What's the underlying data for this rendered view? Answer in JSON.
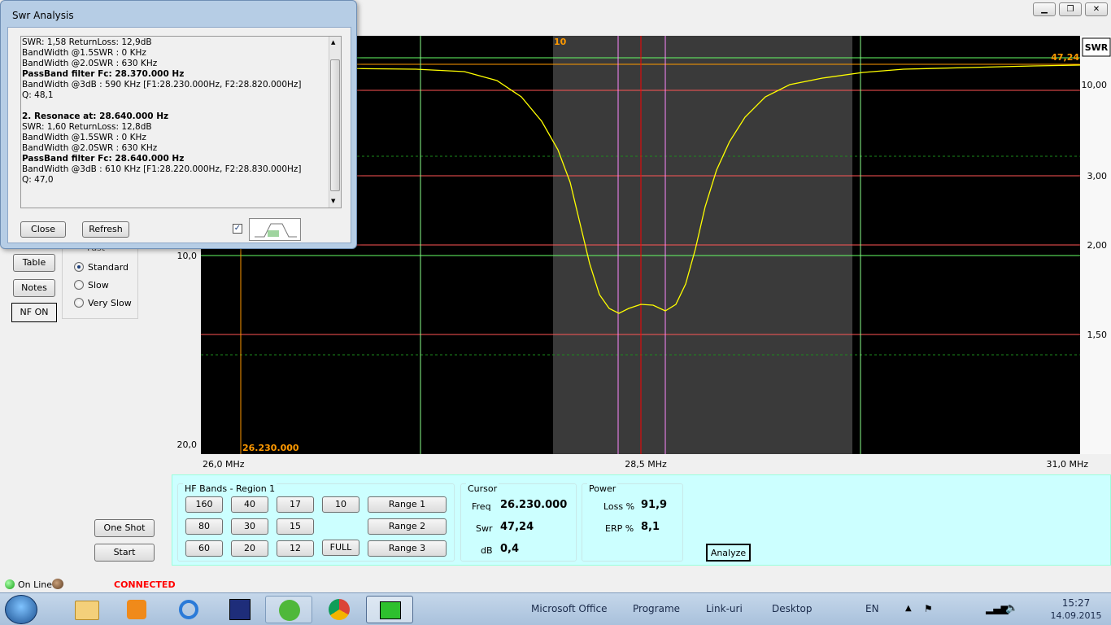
{
  "dialog": {
    "title": "Swr Analysis",
    "lines": [
      {
        "text": "SWR: 1,58 ReturnLoss: 12,9dB",
        "bold": false
      },
      {
        "text": "BandWidth @1.5SWR : 0 KHz",
        "bold": false
      },
      {
        "text": "BandWidth @2.0SWR : 630 KHz",
        "bold": false
      },
      {
        "text": "PassBand filter Fc: 28.370.000 Hz",
        "bold": true
      },
      {
        "text": "BandWidth @3dB : 590 KHz [F1:28.230.000Hz, F2:28.820.000Hz]",
        "bold": false
      },
      {
        "text": "Q: 48,1",
        "bold": false
      },
      {
        "text": "",
        "bold": false
      },
      {
        "text": "2. Resonace at: 28.640.000 Hz",
        "bold": true
      },
      {
        "text": "SWR: 1,60 ReturnLoss: 12,8dB",
        "bold": false
      },
      {
        "text": "BandWidth @1.5SWR : 0 KHz",
        "bold": false
      },
      {
        "text": "BandWidth @2.0SWR : 630 KHz",
        "bold": false
      },
      {
        "text": "PassBand filter Fc: 28.640.000 Hz",
        "bold": true
      },
      {
        "text": "BandWidth @3dB : 610 KHz [F1:28.220.000Hz, F2:28.830.000Hz]",
        "bold": false
      },
      {
        "text": "Q: 47,0",
        "bold": false
      }
    ],
    "close_label": "Close",
    "refresh_label": "Refresh",
    "checkbox_checked": true
  },
  "left_panel": {
    "table_label": "Table",
    "notes_label": "Notes",
    "nf_label": "NF ON",
    "speed_options": [
      {
        "label": "Fast",
        "selected": false
      },
      {
        "label": "Standard",
        "selected": true
      },
      {
        "label": "Slow",
        "selected": false
      },
      {
        "label": "Very Slow",
        "selected": false
      }
    ],
    "one_shot_label": "One Shot",
    "start_label": "Start"
  },
  "plot": {
    "swr_header": "SWR",
    "marker_top": "10",
    "cursor_swr_readout": "47,24",
    "cursor_freq_readout": "26.230.000",
    "left_axis_labels": [
      "10,0",
      "20,0"
    ],
    "right_axis_labels": [
      "10,00",
      "3,00",
      "2,00",
      "1,50"
    ],
    "x_axis_labels": [
      "26,0 MHz",
      "28,5 MHz",
      "31,0 MHz"
    ],
    "highlight_color": "#ff9900",
    "trace_color": "#ffff00"
  },
  "hf_bands": {
    "title": "HF Bands - Region 1",
    "buttons": [
      "160",
      "40",
      "17",
      "10",
      "80",
      "30",
      "15",
      "60",
      "20",
      "12",
      "FULL"
    ],
    "ranges": [
      "Range 1",
      "Range 2",
      "Range 3"
    ]
  },
  "cursor_box": {
    "title": "Cursor",
    "freq_label": "Freq",
    "freq_value": "26.230.000",
    "swr_label": "Swr",
    "swr_value": "47,24",
    "db_label": "dB",
    "db_value": "0,4"
  },
  "power_box": {
    "title": "Power",
    "loss_label": "Loss %",
    "loss_value": "91,9",
    "erp_label": "ERP %",
    "erp_value": "8,1"
  },
  "analyze_label": "Analyze",
  "status": {
    "online_label": "On Line",
    "connected_label": "CONNECTED",
    "connected_color": "#ff0000"
  },
  "taskbar": {
    "items": [
      "Microsoft Office",
      "Programe",
      "Link-uri",
      "Desktop"
    ],
    "lang": "EN",
    "time": "15:27",
    "date": "14.09.2015"
  }
}
